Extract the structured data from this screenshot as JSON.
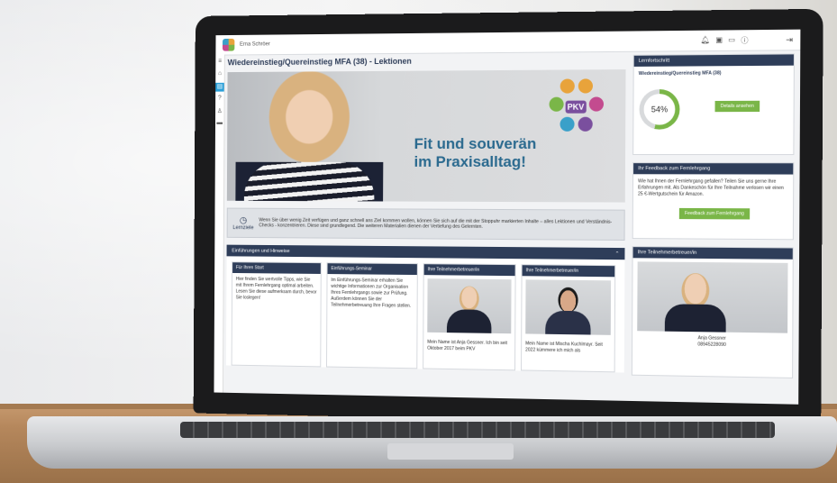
{
  "app": {
    "user_name": "Erna Schröer",
    "page_title": "Wiedereinstieg/Quereinstieg MFA (38) - Lektionen"
  },
  "topbar_icons": [
    "bell-icon",
    "inbox-icon",
    "pkv-badge-icon",
    "help-icon",
    "logout-icon"
  ],
  "hero": {
    "headline_1": "Fit und souverän",
    "headline_2": "im Praxisalltag!",
    "badge": "PKV"
  },
  "notice": {
    "label": "Lernziele",
    "text": "Wenn Sie über wenig Zeit verfügen und ganz schnell ans Ziel kommen wollen, können Sie sich auf die mit der Stoppuhr markierten Inhalte – alles Lektionen und Verständnis-Checks - konzentrieren. Diese sind grundlegend. Die weiteren Materialien dienen der Vertiefung des Gelernten."
  },
  "intro_panel": {
    "title": "Einführungen und Hinweise",
    "cards": [
      {
        "title": "Für Ihren Start",
        "body": "Hier finden Sie wertvolle Tipps, wie Sie mit Ihrem Fernlehrgang optimal arbeiten. Lesen Sie diese aufmerksam durch, bevor Sie loslegen!"
      },
      {
        "title": "Einführungs-Seminar",
        "body": "Im Einführungs-Seminar erhalten Sie wichtige Informationen zur Organisation Ihres Fernlehrgangs sowie zur Prüfung. Außerdem können Sie der Teilnehmerbetreuung Ihre Fragen stellen."
      },
      {
        "title": "Ihre Teilnehmerbetreuer/in",
        "body": "Mein Name ist Anja Gessner. Ich bin seit Oktober 2017 beim PKV"
      },
      {
        "title": "Ihre Teilnehmerbetreuer/in",
        "body": "Mein Name ist Mischa Kuchlmayr. Seit 2022 kümmere ich mich als"
      }
    ]
  },
  "progress": {
    "title": "Lernfortschritt",
    "course": "Wiedereinstieg/Quereinstieg MFA (38)",
    "percent_label": "54%",
    "percent": 54,
    "details_button": "Details ansehen"
  },
  "feedback": {
    "title": "Ihr Feedback zum Fernlehrgang",
    "text": "Wie hat Ihnen der Fernlehrgang gefallen? Teilen Sie uns gerne Ihre Erfahrungen mit. Als Dankeschön für Ihre Teilnahme verlosen wir einen 25 €-Wertgutschein für Amazon.",
    "button": "Feedback zum Fernlehrgang"
  },
  "advisor": {
    "title": "Ihre Teilnehmerbetreuer/in",
    "name": "Anja Gessner",
    "phone": "08945228090"
  },
  "colors": {
    "nav_dark": "#2e3d59",
    "accent_green": "#7ab648",
    "accent_blue": "#2a9fd8",
    "headline_blue": "#2b6a8f"
  }
}
